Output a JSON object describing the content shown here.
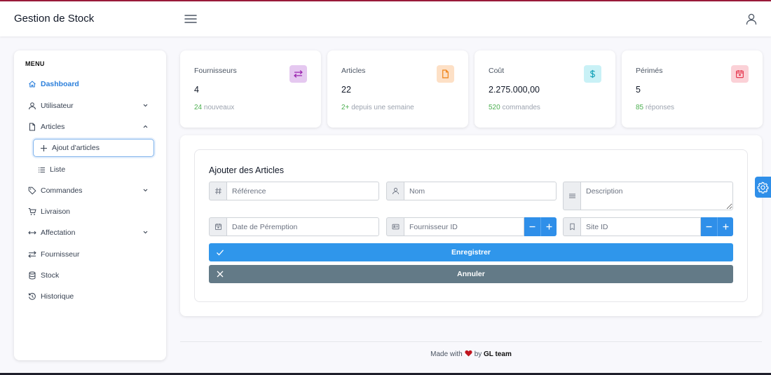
{
  "app": {
    "title": "Gestion de Stock"
  },
  "topbar": {
    "menu_icon": "hamburger-icon",
    "user_icon": "user-icon"
  },
  "sidebar": {
    "heading": "MENU",
    "items": [
      {
        "label": "Dashboard",
        "icon": "home-icon",
        "active": true
      },
      {
        "label": "Utilisateur",
        "icon": "user-icon",
        "expandable": true
      },
      {
        "label": "Articles",
        "icon": "file-icon",
        "expandable": true,
        "expanded": true
      },
      {
        "label": "Ajout d'articles",
        "icon": "plus-icon",
        "sub": true,
        "selected": true
      },
      {
        "label": "Liste",
        "icon": "list-icon",
        "sub": true
      },
      {
        "label": "Commandes",
        "icon": "tag-icon",
        "expandable": true
      },
      {
        "label": "Livraison",
        "icon": "cart-icon"
      },
      {
        "label": "Affectation",
        "icon": "arrows-horizontal-icon",
        "expandable": true
      },
      {
        "label": "Fournisseur",
        "icon": "transfer-icon"
      },
      {
        "label": "Stock",
        "icon": "database-icon"
      },
      {
        "label": "Historique",
        "icon": "history-icon"
      }
    ]
  },
  "stats": [
    {
      "label": "Fournisseurs",
      "value": "4",
      "foot_highlight": "24",
      "foot_text": "nouveaux",
      "icon": "transfer-icon",
      "icon_color": "#9c27b0",
      "icon_bg": "#e5c8f0"
    },
    {
      "label": "Articles",
      "value": "22",
      "foot_highlight": "2+",
      "foot_text": "depuis une semaine",
      "icon": "file-icon",
      "icon_color": "#f08a24",
      "icon_bg": "#fde0c6"
    },
    {
      "label": "Coût",
      "value": "2.275.000,00",
      "foot_highlight": "520",
      "foot_text": "commandes",
      "icon": "dollar-icon",
      "icon_color": "#17a2b8",
      "icon_bg": "#c9f1f6"
    },
    {
      "label": "Périmés",
      "value": "5",
      "foot_highlight": "85",
      "foot_text": "réponses",
      "icon": "calendar-icon",
      "icon_color": "#e53950",
      "icon_bg": "#fbd1d7"
    }
  ],
  "form": {
    "title": "Ajouter des Articles",
    "fields": {
      "reference": {
        "placeholder": "Référence",
        "icon": "hash-icon"
      },
      "nom": {
        "placeholder": "Nom",
        "icon": "user-icon"
      },
      "description": {
        "placeholder": "Description",
        "icon": "lines-icon"
      },
      "date_peremption": {
        "placeholder": "Date de Péremption",
        "icon": "calendar-icon"
      },
      "fournisseur_id": {
        "placeholder": "Fournisseur ID",
        "icon": "id-card-icon"
      },
      "site_id": {
        "placeholder": "Site ID",
        "icon": "bookmark-icon"
      }
    },
    "save_label": "Enregistrer",
    "cancel_label": "Annuler"
  },
  "footer": {
    "made_with": "Made with",
    "by": "by",
    "team": "GL team"
  },
  "colors": {
    "primary": "#2f96eb",
    "secondary": "#637a87",
    "success": "#4caf50",
    "accent_top": "#9b1b3a"
  }
}
